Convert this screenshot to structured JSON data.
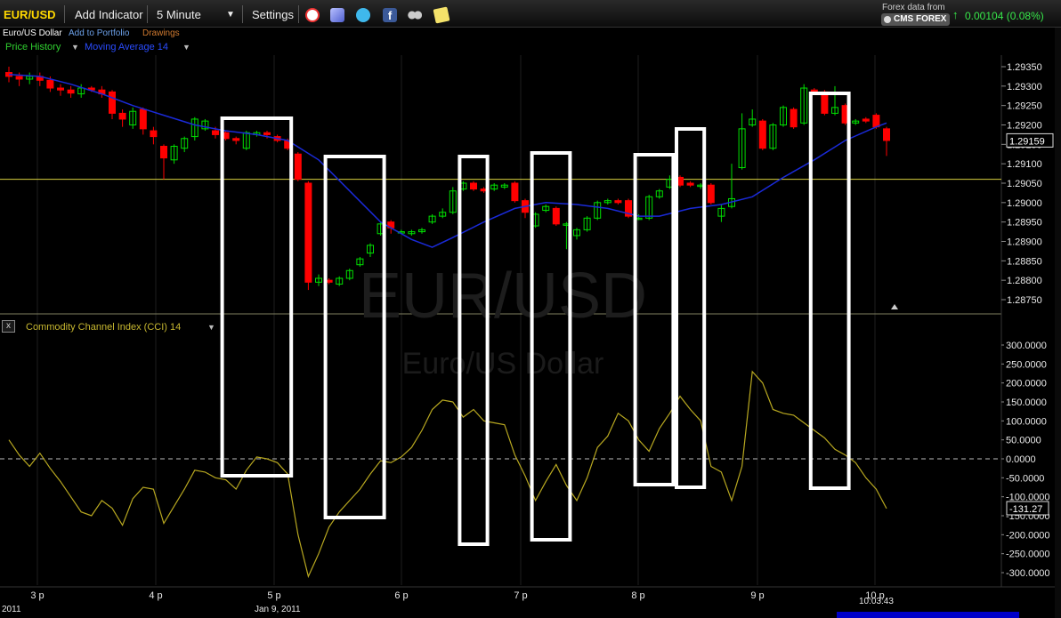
{
  "toolbar": {
    "symbol": "EUR/USD",
    "add_indicator": "Add Indicator",
    "interval": "5 Minute",
    "settings": "Settings",
    "forex_data_from": "Forex data from",
    "provider": "CMS FOREX",
    "change": "0.00104 (0.08%)",
    "icons": [
      "alarm-clock-icon",
      "layers-icon",
      "twitter-icon",
      "facebook-icon",
      "binoculars-icon",
      "notes-icon"
    ]
  },
  "subbar": {
    "instrument": "Euro/US Dollar",
    "add_to_portfolio": "Add to Portfolio",
    "drawings": "Drawings"
  },
  "series": {
    "price_history": "Price History",
    "moving_average": "Moving Average 14"
  },
  "cci": {
    "close": "x",
    "label": "Commodity Channel Index (CCI) 14"
  },
  "watermark": {
    "symbol": "EUR/USD",
    "name": "Euro/US Dollar"
  },
  "time_axis": {
    "ticks": [
      "3 p",
      "4 p",
      "5 p",
      "6 p",
      "7 p",
      "8 p",
      "9 p",
      "10 p"
    ],
    "date_left": "2011",
    "date_mid": "Jan 9, 2011",
    "cursor_time": "10:03:43"
  },
  "colors": {
    "up": "#00e000",
    "down": "#ff0000",
    "ma": "#1a2ad8",
    "cci": "#b8a820",
    "hline": "#d8d040",
    "accent": "#ffd800",
    "change": "#37e84a"
  },
  "chart_data": [
    {
      "type": "candlestick",
      "title": "Price History",
      "y_ticks": [
        "1.29350",
        "1.29300",
        "1.29250",
        "1.29200",
        "1.29150",
        "1.29100",
        "1.29050",
        "1.29000",
        "1.28950",
        "1.28900",
        "1.28850",
        "1.28800",
        "1.28750"
      ],
      "ylim": [
        1.2872,
        1.2937
      ],
      "last_value": "1.29159",
      "horizontal_line": 1.2906,
      "candles": [
        {
          "t": 0,
          "o": 1.29335,
          "c": 1.29325,
          "h": 1.2935,
          "l": 1.2931
        },
        {
          "t": 1,
          "o": 1.29325,
          "c": 1.29318,
          "h": 1.29335,
          "l": 1.293
        },
        {
          "t": 2,
          "o": 1.29318,
          "c": 1.29325,
          "h": 1.29335,
          "l": 1.29305
        },
        {
          "t": 3,
          "o": 1.29325,
          "c": 1.29315,
          "h": 1.29335,
          "l": 1.293
        },
        {
          "t": 4,
          "o": 1.29315,
          "c": 1.29295,
          "h": 1.29325,
          "l": 1.29285
        },
        {
          "t": 5,
          "o": 1.29295,
          "c": 1.2929,
          "h": 1.29305,
          "l": 1.29275
        },
        {
          "t": 6,
          "o": 1.2929,
          "c": 1.29282,
          "h": 1.293,
          "l": 1.2927
        },
        {
          "t": 7,
          "o": 1.2928,
          "c": 1.29295,
          "h": 1.29305,
          "l": 1.2927
        },
        {
          "t": 8,
          "o": 1.29295,
          "c": 1.2929,
          "h": 1.293,
          "l": 1.29285
        },
        {
          "t": 9,
          "o": 1.2929,
          "c": 1.2928,
          "h": 1.293,
          "l": 1.2927
        },
        {
          "t": 10,
          "o": 1.29285,
          "c": 1.2923,
          "h": 1.2929,
          "l": 1.29215
        },
        {
          "t": 11,
          "o": 1.2923,
          "c": 1.29215,
          "h": 1.2924,
          "l": 1.29195
        },
        {
          "t": 12,
          "o": 1.292,
          "c": 1.29235,
          "h": 1.29245,
          "l": 1.2919
        },
        {
          "t": 13,
          "o": 1.2924,
          "c": 1.2919,
          "h": 1.29245,
          "l": 1.29175
        },
        {
          "t": 14,
          "o": 1.29185,
          "c": 1.2917,
          "h": 1.29195,
          "l": 1.2915
        },
        {
          "t": 15,
          "o": 1.29145,
          "c": 1.29115,
          "h": 1.2915,
          "l": 1.2906
        },
        {
          "t": 16,
          "o": 1.2911,
          "c": 1.29145,
          "h": 1.2915,
          "l": 1.291
        },
        {
          "t": 17,
          "o": 1.2914,
          "c": 1.29165,
          "h": 1.2917,
          "l": 1.2913
        },
        {
          "t": 18,
          "o": 1.2917,
          "c": 1.29215,
          "h": 1.2922,
          "l": 1.2916
        },
        {
          "t": 19,
          "o": 1.2919,
          "c": 1.2921,
          "h": 1.29215,
          "l": 1.29185
        },
        {
          "t": 20,
          "o": 1.29185,
          "c": 1.29175,
          "h": 1.29195,
          "l": 1.29165
        },
        {
          "t": 21,
          "o": 1.2918,
          "c": 1.29165,
          "h": 1.29185,
          "l": 1.2916
        },
        {
          "t": 22,
          "o": 1.29165,
          "c": 1.2916,
          "h": 1.2917,
          "l": 1.2915
        },
        {
          "t": 23,
          "o": 1.2914,
          "c": 1.2918,
          "h": 1.29185,
          "l": 1.29135
        },
        {
          "t": 24,
          "o": 1.29175,
          "c": 1.2918,
          "h": 1.29185,
          "l": 1.2917
        },
        {
          "t": 25,
          "o": 1.2918,
          "c": 1.29175,
          "h": 1.29185,
          "l": 1.29165
        },
        {
          "t": 26,
          "o": 1.2917,
          "c": 1.2916,
          "h": 1.29175,
          "l": 1.29155
        },
        {
          "t": 27,
          "o": 1.2916,
          "c": 1.2914,
          "h": 1.29165,
          "l": 1.29135
        },
        {
          "t": 28,
          "o": 1.29125,
          "c": 1.2906,
          "h": 1.2913,
          "l": 1.29055
        },
        {
          "t": 29,
          "o": 1.2905,
          "c": 1.28795,
          "h": 1.29055,
          "l": 1.28775
        },
        {
          "t": 30,
          "o": 1.28795,
          "c": 1.28805,
          "h": 1.28815,
          "l": 1.28785
        },
        {
          "t": 31,
          "o": 1.288,
          "c": 1.28795,
          "h": 1.28805,
          "l": 1.2879
        },
        {
          "t": 32,
          "o": 1.2879,
          "c": 1.28805,
          "h": 1.2881,
          "l": 1.28785
        },
        {
          "t": 33,
          "o": 1.28805,
          "c": 1.28825,
          "h": 1.2883,
          "l": 1.288
        },
        {
          "t": 34,
          "o": 1.2884,
          "c": 1.28855,
          "h": 1.2886,
          "l": 1.28835
        },
        {
          "t": 35,
          "o": 1.2887,
          "c": 1.2889,
          "h": 1.28895,
          "l": 1.2886
        },
        {
          "t": 36,
          "o": 1.2892,
          "c": 1.28945,
          "h": 1.2895,
          "l": 1.28915
        },
        {
          "t": 37,
          "o": 1.2895,
          "c": 1.28935,
          "h": 1.28955,
          "l": 1.2892
        },
        {
          "t": 38,
          "o": 1.28925,
          "c": 1.28925,
          "h": 1.2893,
          "l": 1.2892
        },
        {
          "t": 39,
          "o": 1.2892,
          "c": 1.28925,
          "h": 1.2893,
          "l": 1.28915
        },
        {
          "t": 40,
          "o": 1.28925,
          "c": 1.2893,
          "h": 1.28935,
          "l": 1.2892
        },
        {
          "t": 41,
          "o": 1.2895,
          "c": 1.28965,
          "h": 1.2897,
          "l": 1.28945
        },
        {
          "t": 42,
          "o": 1.28965,
          "c": 1.28975,
          "h": 1.28985,
          "l": 1.2896
        },
        {
          "t": 43,
          "o": 1.28975,
          "c": 1.2903,
          "h": 1.2904,
          "l": 1.2897
        },
        {
          "t": 44,
          "o": 1.29035,
          "c": 1.2905,
          "h": 1.29055,
          "l": 1.2903
        },
        {
          "t": 45,
          "o": 1.2905,
          "c": 1.29035,
          "h": 1.29055,
          "l": 1.2903
        },
        {
          "t": 46,
          "o": 1.29035,
          "c": 1.2903,
          "h": 1.2904,
          "l": 1.29025
        },
        {
          "t": 47,
          "o": 1.29035,
          "c": 1.29045,
          "h": 1.2905,
          "l": 1.2903
        },
        {
          "t": 48,
          "o": 1.2904,
          "c": 1.29045,
          "h": 1.2905,
          "l": 1.29035
        },
        {
          "t": 49,
          "o": 1.2905,
          "c": 1.29005,
          "h": 1.29055,
          "l": 1.29
        },
        {
          "t": 50,
          "o": 1.29005,
          "c": 1.28975,
          "h": 1.2901,
          "l": 1.2896
        },
        {
          "t": 51,
          "o": 1.2894,
          "c": 1.2897,
          "h": 1.28975,
          "l": 1.28935
        },
        {
          "t": 52,
          "o": 1.2898,
          "c": 1.2899,
          "h": 1.28995,
          "l": 1.28975
        },
        {
          "t": 53,
          "o": 1.28985,
          "c": 1.28945,
          "h": 1.2899,
          "l": 1.2894
        },
        {
          "t": 54,
          "o": 1.28945,
          "c": 1.28945,
          "h": 1.2895,
          "l": 1.2888
        },
        {
          "t": 55,
          "o": 1.28915,
          "c": 1.2893,
          "h": 1.28935,
          "l": 1.28905
        },
        {
          "t": 56,
          "o": 1.2893,
          "c": 1.2896,
          "h": 1.28965,
          "l": 1.28925
        },
        {
          "t": 57,
          "o": 1.2896,
          "c": 1.29,
          "h": 1.29005,
          "l": 1.28955
        },
        {
          "t": 58,
          "o": 1.29,
          "c": 1.29005,
          "h": 1.2901,
          "l": 1.28995
        },
        {
          "t": 59,
          "o": 1.29005,
          "c": 1.29,
          "h": 1.2901,
          "l": 1.28995
        },
        {
          "t": 60,
          "o": 1.29005,
          "c": 1.28965,
          "h": 1.2901,
          "l": 1.2896
        },
        {
          "t": 61,
          "o": 1.2896,
          "c": 1.2896,
          "h": 1.2897,
          "l": 1.28955
        },
        {
          "t": 62,
          "o": 1.2896,
          "c": 1.29015,
          "h": 1.2902,
          "l": 1.28955
        },
        {
          "t": 63,
          "o": 1.29015,
          "c": 1.2903,
          "h": 1.29035,
          "l": 1.2901
        },
        {
          "t": 64,
          "o": 1.2904,
          "c": 1.2906,
          "h": 1.2907,
          "l": 1.29035
        },
        {
          "t": 65,
          "o": 1.29065,
          "c": 1.29045,
          "h": 1.2907,
          "l": 1.2904
        },
        {
          "t": 66,
          "o": 1.2905,
          "c": 1.29045,
          "h": 1.29055,
          "l": 1.2904
        },
        {
          "t": 67,
          "o": 1.29045,
          "c": 1.29045,
          "h": 1.2905,
          "l": 1.29035
        },
        {
          "t": 68,
          "o": 1.29045,
          "c": 1.29,
          "h": 1.2905,
          "l": 1.28995
        },
        {
          "t": 69,
          "o": 1.28965,
          "c": 1.28985,
          "h": 1.28995,
          "l": 1.2895
        },
        {
          "t": 70,
          "o": 1.2899,
          "c": 1.2901,
          "h": 1.291,
          "l": 1.28985
        },
        {
          "t": 71,
          "o": 1.2909,
          "c": 1.2919,
          "h": 1.2923,
          "l": 1.29085
        },
        {
          "t": 72,
          "o": 1.292,
          "c": 1.29215,
          "h": 1.2924,
          "l": 1.29195
        },
        {
          "t": 73,
          "o": 1.2921,
          "c": 1.2914,
          "h": 1.29215,
          "l": 1.29135
        },
        {
          "t": 74,
          "o": 1.2914,
          "c": 1.292,
          "h": 1.29205,
          "l": 1.29135
        },
        {
          "t": 75,
          "o": 1.292,
          "c": 1.29245,
          "h": 1.2925,
          "l": 1.29195
        },
        {
          "t": 76,
          "o": 1.2924,
          "c": 1.29195,
          "h": 1.29245,
          "l": 1.2919
        },
        {
          "t": 77,
          "o": 1.29205,
          "c": 1.29295,
          "h": 1.29305,
          "l": 1.292
        },
        {
          "t": 78,
          "o": 1.2929,
          "c": 1.29285,
          "h": 1.29295,
          "l": 1.2928
        },
        {
          "t": 79,
          "o": 1.29285,
          "c": 1.2923,
          "h": 1.2929,
          "l": 1.29225
        },
        {
          "t": 80,
          "o": 1.2923,
          "c": 1.29245,
          "h": 1.293,
          "l": 1.29225
        },
        {
          "t": 81,
          "o": 1.2925,
          "c": 1.29205,
          "h": 1.29255,
          "l": 1.292
        },
        {
          "t": 82,
          "o": 1.29205,
          "c": 1.2921,
          "h": 1.29215,
          "l": 1.292
        },
        {
          "t": 83,
          "o": 1.29215,
          "c": 1.2921,
          "h": 1.2922,
          "l": 1.29205
        },
        {
          "t": 84,
          "o": 1.29225,
          "c": 1.29195,
          "h": 1.2923,
          "l": 1.2919
        },
        {
          "t": 85,
          "o": 1.2919,
          "c": 1.2916,
          "h": 1.29195,
          "l": 1.2912
        }
      ],
      "moving_average": [
        [
          0,
          1.2933
        ],
        [
          3,
          1.29325
        ],
        [
          6,
          1.29305
        ],
        [
          9,
          1.2928
        ],
        [
          12,
          1.2925
        ],
        [
          15,
          1.29225
        ],
        [
          18,
          1.292
        ],
        [
          21,
          1.29185
        ],
        [
          24,
          1.29175
        ],
        [
          27,
          1.2916
        ],
        [
          30,
          1.2911
        ],
        [
          33,
          1.2903
        ],
        [
          36,
          1.2895
        ],
        [
          39,
          1.28905
        ],
        [
          41,
          1.28885
        ],
        [
          43,
          1.2891
        ],
        [
          46,
          1.2895
        ],
        [
          49,
          1.28985
        ],
        [
          52,
          1.29
        ],
        [
          55,
          1.28995
        ],
        [
          58,
          1.28985
        ],
        [
          61,
          1.28965
        ],
        [
          63,
          1.28965
        ],
        [
          66,
          1.28985
        ],
        [
          69,
          1.28995
        ],
        [
          72,
          1.29015
        ],
        [
          75,
          1.29065
        ],
        [
          78,
          1.2911
        ],
        [
          81,
          1.2916
        ],
        [
          84,
          1.29195
        ],
        [
          85,
          1.29205
        ]
      ]
    },
    {
      "type": "line",
      "title": "Commodity Channel Index (CCI) 14",
      "y_ticks": [
        "300.0000",
        "250.0000",
        "200.0000",
        "150.0000",
        "100.0000",
        "50.0000",
        "0.0000",
        "-50.0000",
        "-100.0000",
        "-150.0000",
        "-200.0000",
        "-250.0000",
        "-300.0000"
      ],
      "ylim": [
        -310,
        310
      ],
      "last_value": "-131.27",
      "zero_line": 0,
      "values": [
        [
          0,
          50
        ],
        [
          1,
          10
        ],
        [
          2,
          -20
        ],
        [
          3,
          15
        ],
        [
          4,
          -25
        ],
        [
          5,
          -60
        ],
        [
          6,
          -100
        ],
        [
          7,
          -140
        ],
        [
          8,
          -150
        ],
        [
          9,
          -110
        ],
        [
          10,
          -130
        ],
        [
          11,
          -175
        ],
        [
          12,
          -105
        ],
        [
          13,
          -75
        ],
        [
          14,
          -80
        ],
        [
          15,
          -170
        ],
        [
          16,
          -125
        ],
        [
          17,
          -80
        ],
        [
          18,
          -30
        ],
        [
          19,
          -35
        ],
        [
          20,
          -50
        ],
        [
          21,
          -55
        ],
        [
          22,
          -80
        ],
        [
          23,
          -30
        ],
        [
          24,
          5
        ],
        [
          25,
          0
        ],
        [
          26,
          -10
        ],
        [
          27,
          -40
        ],
        [
          28,
          -200
        ],
        [
          29,
          -310
        ],
        [
          30,
          -250
        ],
        [
          31,
          -180
        ],
        [
          32,
          -140
        ],
        [
          33,
          -110
        ],
        [
          34,
          -80
        ],
        [
          35,
          -40
        ],
        [
          36,
          -5
        ],
        [
          37,
          -10
        ],
        [
          38,
          5
        ],
        [
          39,
          30
        ],
        [
          40,
          75
        ],
        [
          41,
          130
        ],
        [
          42,
          155
        ],
        [
          43,
          150
        ],
        [
          44,
          110
        ],
        [
          45,
          130
        ],
        [
          46,
          100
        ],
        [
          47,
          95
        ],
        [
          48,
          90
        ],
        [
          49,
          10
        ],
        [
          50,
          -45
        ],
        [
          51,
          -110
        ],
        [
          52,
          -60
        ],
        [
          53,
          -15
        ],
        [
          54,
          -70
        ],
        [
          55,
          -110
        ],
        [
          56,
          -50
        ],
        [
          57,
          30
        ],
        [
          58,
          60
        ],
        [
          59,
          120
        ],
        [
          60,
          100
        ],
        [
          61,
          50
        ],
        [
          62,
          20
        ],
        [
          63,
          80
        ],
        [
          64,
          120
        ],
        [
          65,
          165
        ],
        [
          66,
          130
        ],
        [
          67,
          100
        ],
        [
          68,
          -20
        ],
        [
          69,
          -35
        ],
        [
          70,
          -110
        ],
        [
          71,
          -20
        ],
        [
          72,
          230
        ],
        [
          73,
          200
        ],
        [
          74,
          130
        ],
        [
          75,
          120
        ],
        [
          76,
          115
        ],
        [
          77,
          95
        ],
        [
          78,
          75
        ],
        [
          79,
          55
        ],
        [
          80,
          25
        ],
        [
          81,
          10
        ],
        [
          82,
          -10
        ],
        [
          83,
          -50
        ],
        [
          84,
          -80
        ],
        [
          85,
          -131
        ]
      ],
      "highlight_boxes": [
        [
          21,
          27
        ],
        [
          31,
          36
        ],
        [
          44,
          46
        ],
        [
          51,
          54
        ],
        [
          61,
          64
        ],
        [
          65,
          67
        ],
        [
          78,
          81
        ]
      ]
    }
  ]
}
